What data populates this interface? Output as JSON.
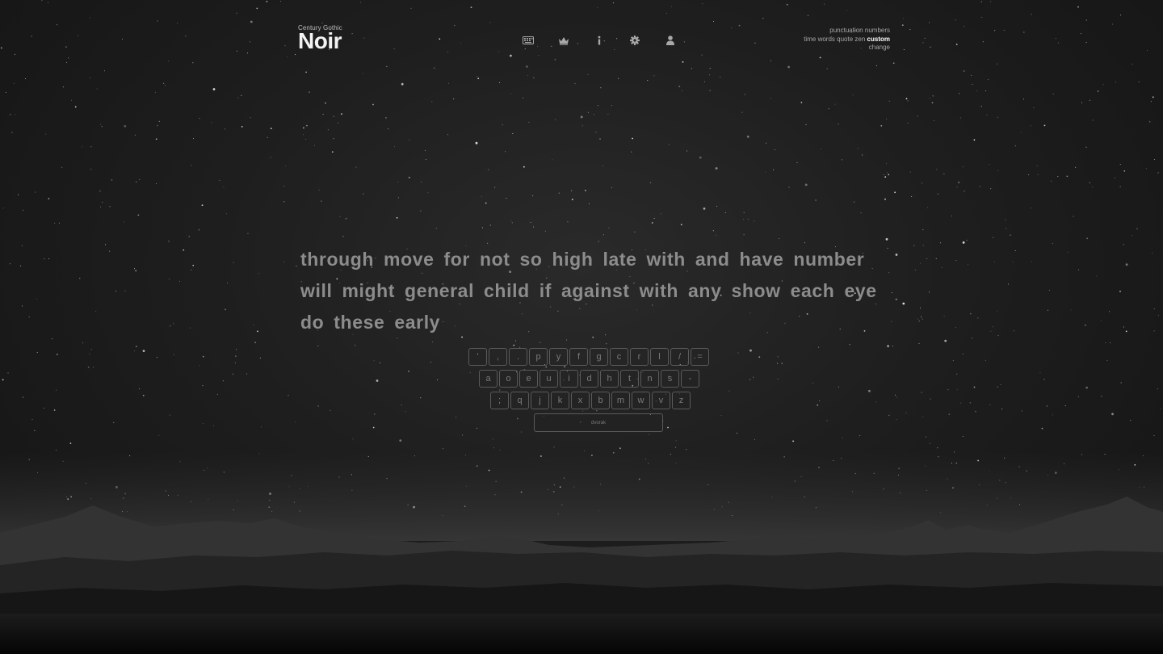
{
  "brand": {
    "subtitle": "Century Gothic",
    "title": "Noir"
  },
  "nav": [
    {
      "name": "keyboard-icon"
    },
    {
      "name": "crown-icon"
    },
    {
      "name": "info-icon"
    },
    {
      "name": "gear-icon"
    },
    {
      "name": "user-icon"
    }
  ],
  "config": {
    "row1": [
      "punctuation",
      "numbers"
    ],
    "row2": [
      "time",
      "words",
      "quote",
      "zen",
      "custom"
    ],
    "active": "custom",
    "row3": [
      "change"
    ]
  },
  "test": {
    "words": "through move for not so high late with and have number will might general child if against with any show each eye do these early"
  },
  "keymap": {
    "rows": [
      [
        "'",
        ",",
        ".",
        "p",
        "y",
        "f",
        "g",
        "c",
        "r",
        "l",
        "/",
        "="
      ],
      [
        "a",
        "o",
        "e",
        "u",
        "i",
        "d",
        "h",
        "t",
        "n",
        "s",
        "-"
      ],
      [
        ";",
        "q",
        "j",
        "k",
        "x",
        "b",
        "m",
        "w",
        "v",
        "z"
      ]
    ],
    "layout_label": "dvorak"
  }
}
